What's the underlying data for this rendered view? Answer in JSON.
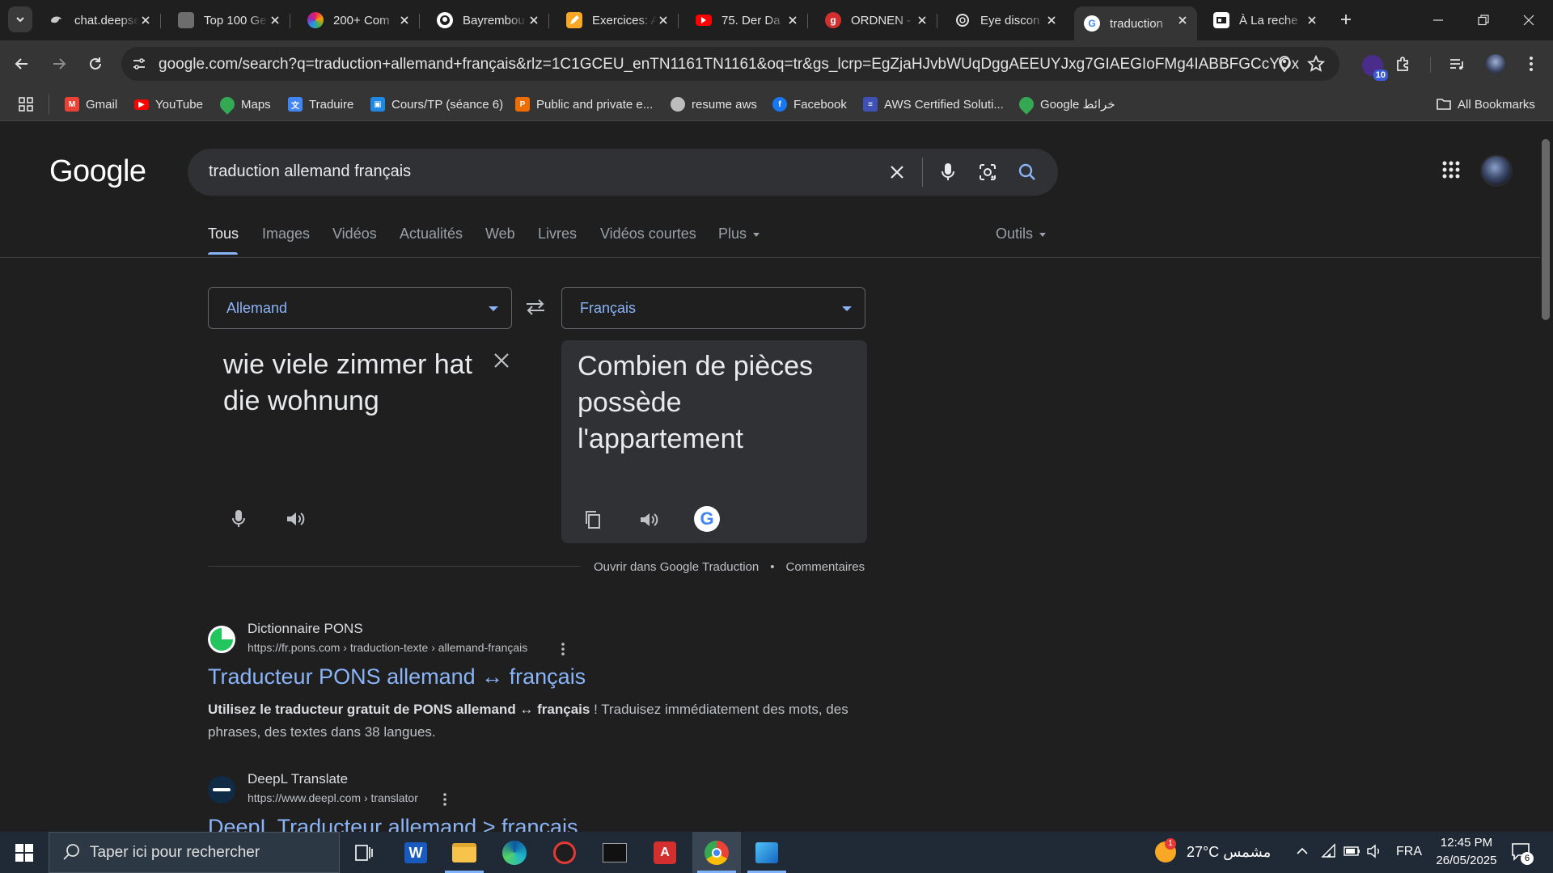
{
  "browser": {
    "tabs": [
      {
        "title": "chat.deepseek",
        "icon": "deepseek-icon",
        "color": "#4d6bfe"
      },
      {
        "title": "Top 100 Ge",
        "icon": "image-favicon",
        "color": "#777777"
      },
      {
        "title": "200+ Com",
        "icon": "colorful-favicon",
        "color": "#c2185b"
      },
      {
        "title": "Bayrembou",
        "icon": "github-icon",
        "color": "#ffffff"
      },
      {
        "title": "Exercices: A",
        "icon": "pencil-favicon",
        "color": "#f9a825"
      },
      {
        "title": "75. Der Da",
        "icon": "youtube-icon",
        "color": "#ff0000"
      },
      {
        "title": "ORDNEN -",
        "icon": "g-favicon",
        "color": "#d32f2f"
      },
      {
        "title": "Eye discon",
        "icon": "openai-icon",
        "color": "#ffffff"
      },
      {
        "title": "traduction",
        "icon": "google-icon",
        "color": "#4285f4",
        "active": true
      },
      {
        "title": "À La reche",
        "icon": "id-card-favicon",
        "color": "#ffffff"
      }
    ],
    "url": "google.com/search?q=traduction+allemand+français&rlz=1C1GCEU_enTN1161TN1161&oq=tr&gs_lcrp=EgZjaHJvbWUqDggAEEUYJxg7GIAEGIoFMg4IABBFGCcYOxiABBiKBTIG...",
    "extension_badge": "10",
    "bookmarks": [
      {
        "label": "Gmail",
        "icon": "gmail-icon",
        "color": "#ea4335"
      },
      {
        "label": "YouTube",
        "icon": "youtube-icon",
        "color": "#ff0000"
      },
      {
        "label": "Maps",
        "icon": "maps-icon",
        "color": "#34a853"
      },
      {
        "label": "Traduire",
        "icon": "translate-icon",
        "color": "#4285f4"
      },
      {
        "label": "Cours/TP (séance 6)",
        "icon": "classroom-icon",
        "color": "#1e88e5"
      },
      {
        "label": "Public and private e...",
        "icon": "p-icon",
        "color": "#ef6c00"
      },
      {
        "label": "resume aws",
        "icon": "globe-icon",
        "color": "#bdbdbd"
      },
      {
        "label": "Facebook",
        "icon": "facebook-icon",
        "color": "#1877f2"
      },
      {
        "label": "AWS Certified Soluti...",
        "icon": "list-icon",
        "color": "#3f51b5"
      },
      {
        "label": "Google خرائط",
        "icon": "maps-icon",
        "color": "#34a853"
      }
    ],
    "all_bookmarks": "All Bookmarks"
  },
  "google": {
    "logo": "Google",
    "query": "traduction allemand français",
    "tabs": [
      "Tous",
      "Images",
      "Vidéos",
      "Actualités",
      "Web",
      "Livres",
      "Vidéos courtes",
      "Plus"
    ],
    "tools": "Outils"
  },
  "translate": {
    "source_lang": "Allemand",
    "target_lang": "Français",
    "source_text": "wie viele zimmer hat die wohnung",
    "target_text": "Combien de pièces possède l'appartement",
    "open_link": "Ouvrir dans Google Traduction",
    "feedback_link": "Commentaires"
  },
  "results": [
    {
      "site": "Dictionnaire PONS",
      "url": "https://fr.pons.com › traduction-texte › allemand-français",
      "title": "Traducteur PONS allemand ↔ français",
      "snippet_bold": "Utilisez le traducteur gratuit de PONS allemand ↔ français",
      "snippet_rest": " ! Traduisez immédiatement des mots, des phrases, des textes dans 38 langues."
    },
    {
      "site": "DeepL Translate",
      "url": "https://www.deepl.com › translator",
      "title": "DeepL Traducteur allemand > français"
    }
  ],
  "taskbar": {
    "search_placeholder": "Taper ici pour rechercher",
    "weather_badge": "1",
    "weather": "27°C  مشمس",
    "language": "FRA",
    "time": "12:45 PM",
    "date": "26/05/2025",
    "notifications": "6"
  }
}
